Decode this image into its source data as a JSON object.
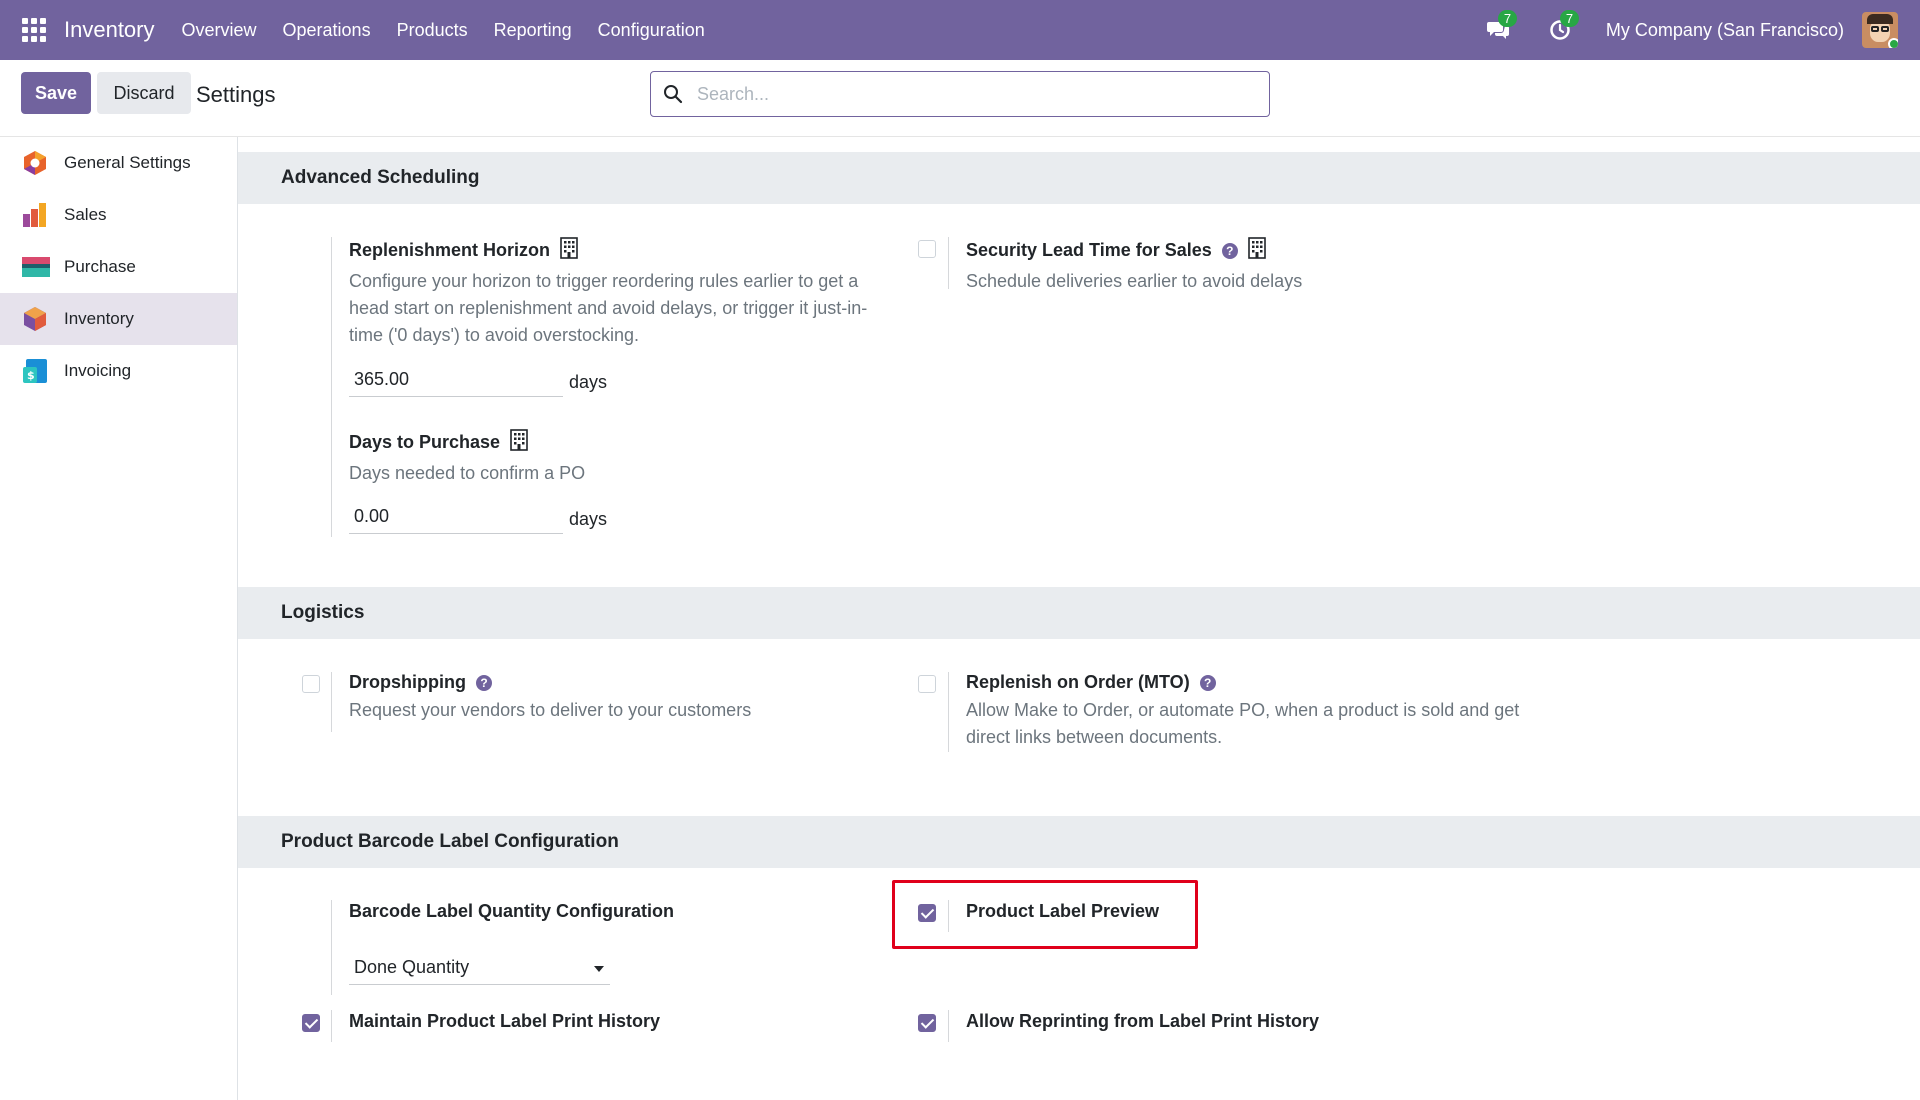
{
  "navbar": {
    "app_name": "Inventory",
    "menu": [
      "Overview",
      "Operations",
      "Products",
      "Reporting",
      "Configuration"
    ],
    "messages_count": "7",
    "activities_count": "7",
    "company": "My Company (San Francisco)"
  },
  "control": {
    "save_label": "Save",
    "discard_label": "Discard",
    "title": "Settings",
    "search_placeholder": "Search..."
  },
  "sidebar": {
    "items": [
      {
        "label": "General Settings",
        "icon": "general-settings-icon"
      },
      {
        "label": "Sales",
        "icon": "sales-icon"
      },
      {
        "label": "Purchase",
        "icon": "purchase-icon"
      },
      {
        "label": "Inventory",
        "icon": "inventory-icon",
        "active": true
      },
      {
        "label": "Invoicing",
        "icon": "invoicing-icon"
      }
    ]
  },
  "sections": {
    "advanced": {
      "title": "Advanced Scheduling",
      "horizon": {
        "title": "Replenishment Horizon",
        "desc": "Configure your horizon to trigger reordering rules earlier to get a head start on replenishment and avoid delays, or trigger it just-in-time ('0 days') to avoid overstocking.",
        "value": "365.00",
        "unit": "days"
      },
      "security": {
        "title": "Security Lead Time for Sales",
        "desc": "Schedule deliveries earlier to avoid delays",
        "checked": false
      },
      "days_purchase": {
        "title": "Days to Purchase",
        "desc": "Days needed to confirm a PO",
        "value": "0.00",
        "unit": "days"
      }
    },
    "logistics": {
      "title": "Logistics",
      "dropshipping": {
        "title": "Dropshipping",
        "desc": "Request your vendors to deliver to your customers",
        "checked": false
      },
      "mto": {
        "title": "Replenish on Order (MTO)",
        "desc": "Allow Make to Order, or automate PO, when a product is sold and get direct links between documents.",
        "checked": false
      }
    },
    "barcode": {
      "title": "Product Barcode Label Configuration",
      "qty_config": {
        "title": "Barcode Label Quantity Configuration",
        "value": "Done Quantity"
      },
      "preview": {
        "title": "Product Label Preview",
        "checked": true
      },
      "history": {
        "title": "Maintain Product Label Print History",
        "checked": true
      },
      "reprint": {
        "title": "Allow Reprinting from Label Print History",
        "checked": true
      }
    }
  },
  "colors": {
    "brand": "#71639e",
    "highlight": "#e0001b",
    "badge": "#28a745"
  }
}
